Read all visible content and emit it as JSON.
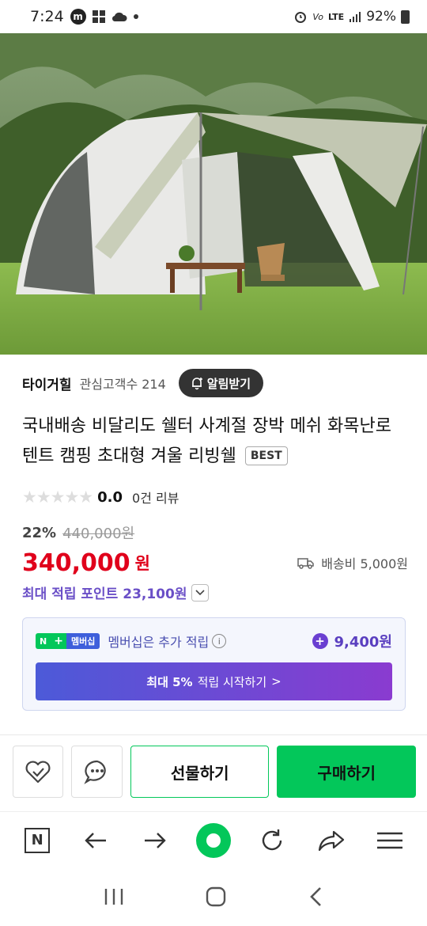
{
  "status_bar": {
    "time": "7:24",
    "app_badge": "m",
    "network": "LTE",
    "battery": "92%"
  },
  "store": {
    "name": "타이거힐",
    "fans_label": "관심고객수 214",
    "alert_label": "알림받기"
  },
  "product": {
    "title": "국내배송 비달리도 쉘터 사계절 장박 메쉬 화목난로 텐트 캠핑 초대형 겨울 리빙쉘",
    "badge": "BEST",
    "rating_stars": "★★★★★",
    "rating": "0.0",
    "reviews": "0건 리뷰",
    "discount": "22%",
    "original_price": "440,000원",
    "price": "340,000",
    "currency": "원",
    "shipping": "배송비 5,000원",
    "points": "최대 적립 포인트 23,100원"
  },
  "membership": {
    "n_label": "N",
    "plus_label": "+",
    "membership_tag": "멤버십",
    "text": "멤버십은 추가 적립",
    "amount": "9,400원",
    "button_label_bold": "최대 5%",
    "button_label_rest": "적립 시작하기",
    "button_arrow": ">"
  },
  "actions": {
    "gift_label": "선물하기",
    "buy_label": "구매하기"
  },
  "browser_nav": {
    "home_label": "N"
  },
  "colors": {
    "naver_green": "#03c75a",
    "price_red": "#e0001b",
    "points_purple": "#6a4fc7"
  }
}
